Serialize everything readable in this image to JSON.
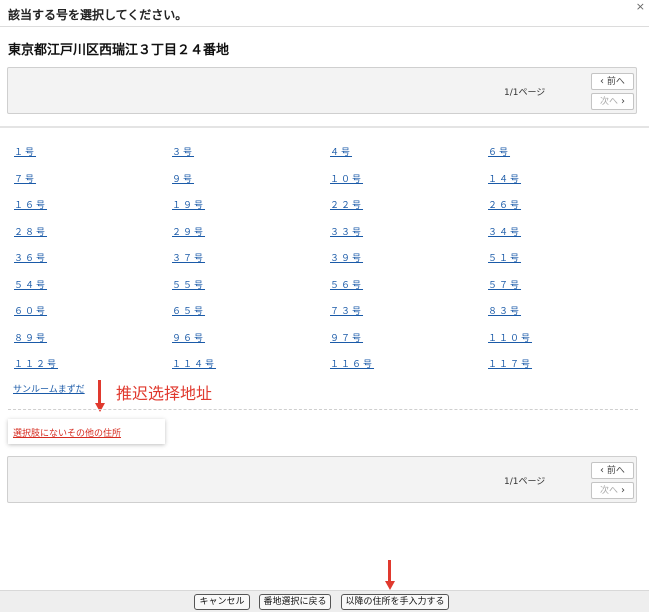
{
  "dialog": {
    "title": "該当する号を選択してください。",
    "close_symbol": "×",
    "address": "東京都江戸川区西瑞江３丁目２４番地"
  },
  "pager": {
    "info": "1/1ページ",
    "prev_label": "前へ",
    "next_label": "次へ"
  },
  "numbers": [
    "１号",
    "３号",
    "４号",
    "６号",
    "７号",
    "９号",
    "１０号",
    "１４号",
    "１６号",
    "１９号",
    "２２号",
    "２６号",
    "２８号",
    "２９号",
    "３３号",
    "３４号",
    "３６号",
    "３７号",
    "３９号",
    "５１号",
    "５４号",
    "５５号",
    "５６号",
    "５７号",
    "６０号",
    "６５号",
    "７３号",
    "８３号",
    "８９号",
    "９６号",
    "９７号",
    "１１０号",
    "１１２号",
    "１１４号",
    "１１６号",
    "１１７号"
  ],
  "sun_room_link": "サンルームまずだ",
  "other_address_link": "選択肢にないその他の住所",
  "annotation_text": "推迟选择地址",
  "annotation_color": "#e0392e",
  "footer": {
    "cancel": "キャンセル",
    "back": "番地選択に戻る",
    "manual": "以降の住所を手入力する"
  }
}
